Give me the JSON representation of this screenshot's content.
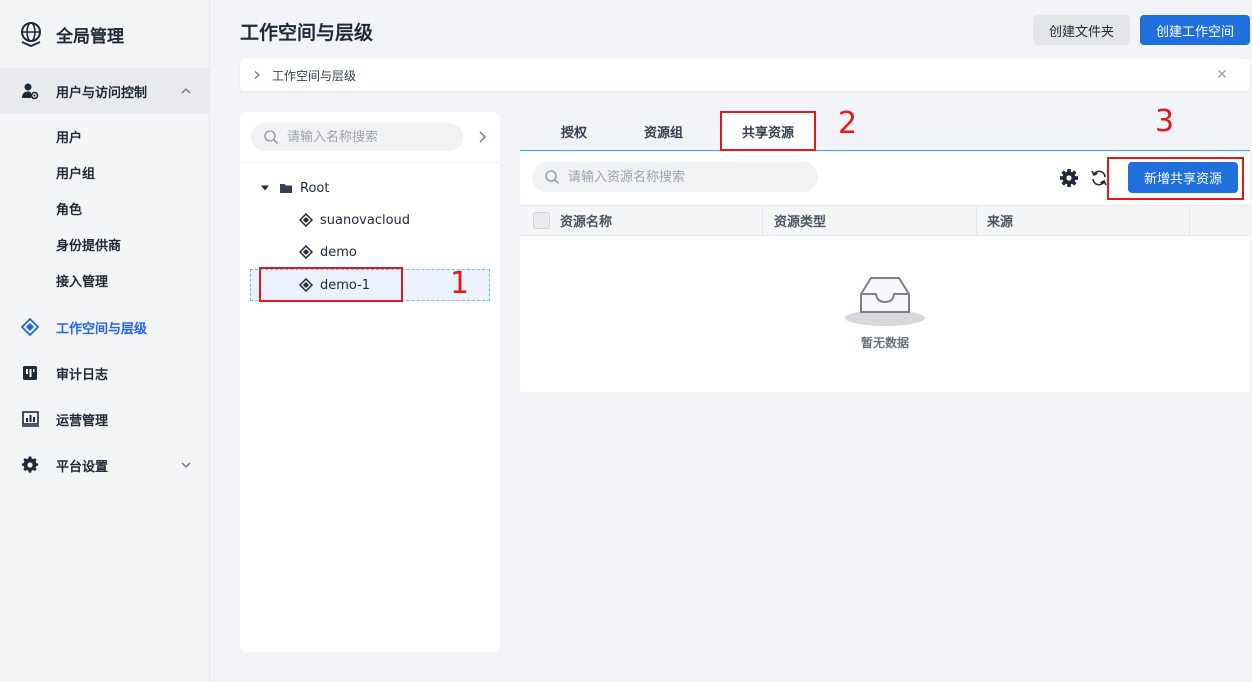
{
  "sidebar": {
    "title": "全局管理",
    "groups": [
      {
        "label": "用户与访问控制",
        "icon": "user-gear-icon"
      }
    ],
    "sub_items": [
      "用户",
      "用户组",
      "角色",
      "身份提供商",
      "接入管理"
    ],
    "items": [
      {
        "label": "工作空间与层级",
        "icon": "workspace-icon",
        "active": true
      },
      {
        "label": "审计日志",
        "icon": "audit-log-icon"
      },
      {
        "label": "运营管理",
        "icon": "operations-chart-icon"
      },
      {
        "label": "平台设置",
        "icon": "gear-icon"
      }
    ]
  },
  "header": {
    "title": "工作空间与层级",
    "create_folder": "创建文件夹",
    "create_workspace": "创建工作空间"
  },
  "breadcrumb": {
    "text": "工作空间与层级"
  },
  "tree": {
    "search_placeholder": "请输入名称搜索",
    "root": "Root",
    "children": [
      "suanovacloud",
      "demo",
      "demo-1"
    ],
    "selected": "demo-1"
  },
  "tabs": {
    "items": [
      "授权",
      "资源组",
      "共享资源"
    ],
    "active": "共享资源"
  },
  "resources": {
    "search_placeholder": "请输入资源名称搜索",
    "add_button": "新增共享资源",
    "columns": [
      "资源名称",
      "资源类型",
      "来源"
    ],
    "empty_text": "暂无数据"
  },
  "annotations": [
    "1",
    "2",
    "3"
  ],
  "colors": {
    "accent": "#1f6fdc",
    "annotation": "#e0191b",
    "tab_underline": "#4aa3df"
  }
}
